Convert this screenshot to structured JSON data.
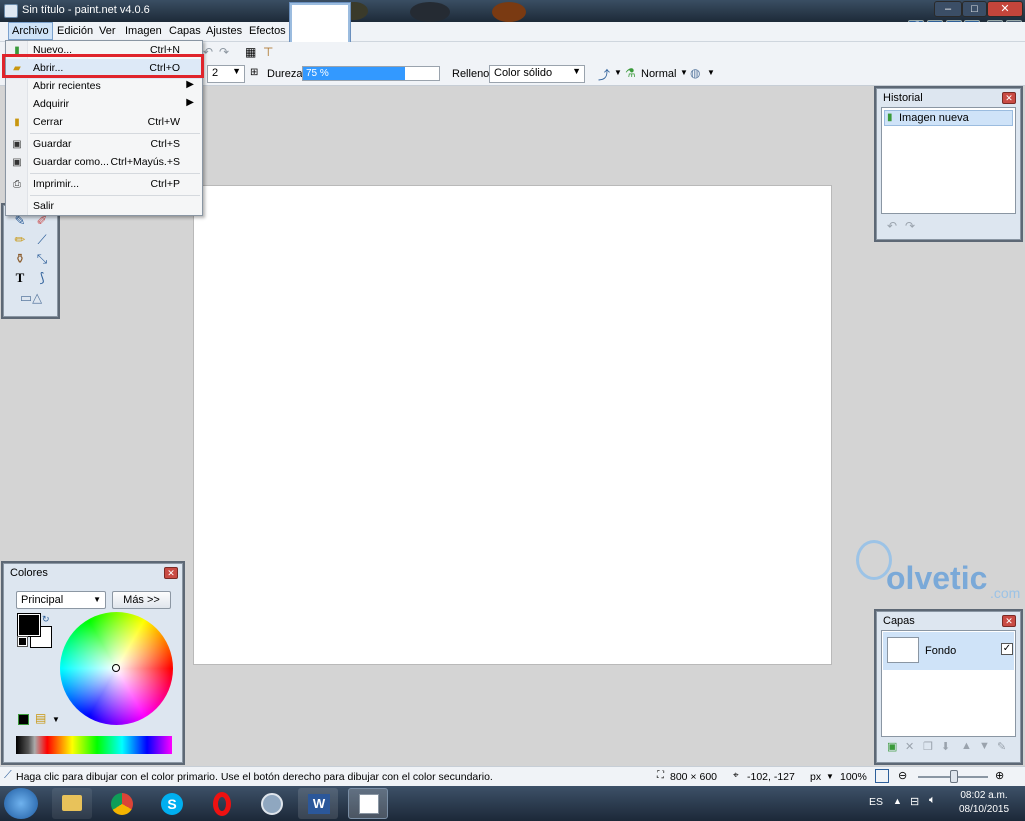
{
  "window": {
    "title": "Sin título - paint.net v4.0.6"
  },
  "menubar": [
    {
      "label": "Archivo"
    },
    {
      "label": "Edición"
    },
    {
      "label": "Ver"
    },
    {
      "label": "Imagen"
    },
    {
      "label": "Capas"
    },
    {
      "label": "Ajustes"
    },
    {
      "label": "Efectos"
    }
  ],
  "file_menu": [
    {
      "label": "Nuevo...",
      "shortcut": "Ctrl+N",
      "icon": "new-file-icon"
    },
    {
      "label": "Abrir...",
      "shortcut": "Ctrl+O",
      "icon": "open-folder-icon"
    },
    {
      "label": "Abrir recientes",
      "shortcut": "",
      "icon": ""
    },
    {
      "label": "Adquirir",
      "shortcut": "",
      "icon": ""
    },
    {
      "label": "Cerrar",
      "shortcut": "Ctrl+W",
      "icon": "close-doc-icon"
    },
    {
      "label": "Guardar",
      "shortcut": "Ctrl+S",
      "icon": "save-icon"
    },
    {
      "label": "Guardar como...",
      "shortcut": "Ctrl+Mayús.+S",
      "icon": "save-as-icon"
    },
    {
      "label": "Imprimir...",
      "shortcut": "Ctrl+P",
      "icon": "print-icon"
    },
    {
      "label": "Salir",
      "shortcut": "",
      "icon": ""
    }
  ],
  "options": {
    "brush_width": "2",
    "hardness_label": "Dureza:",
    "hardness_value": "75 %",
    "hardness_fraction": 0.75,
    "fill_label": "Relleno:",
    "fill_value": "Color sólido",
    "blend_mode": "Normal"
  },
  "history": {
    "title": "Historial",
    "items": [
      "Imagen nueva"
    ]
  },
  "colors_panel": {
    "title": "Colores",
    "mode": "Principal",
    "more_button": "Más >>",
    "primary": "#000000",
    "secondary": "#ffffff"
  },
  "layers": {
    "title": "Capas",
    "items": [
      {
        "name": "Fondo",
        "visible": true
      }
    ]
  },
  "statusbar": {
    "hint": "Haga clic para dibujar con el color primario. Use el botón derecho para dibujar con el color secundario.",
    "image_size": "800 × 600",
    "cursor_pos": "-102, -127",
    "unit": "px",
    "zoom": "100%"
  },
  "taskbar": {
    "lang": "ES",
    "time": "08:02 a.m.",
    "date": "08/10/2015"
  },
  "watermark": "olvetic",
  "watermark_suffix": ".com",
  "highlight_color": "#e0242b"
}
